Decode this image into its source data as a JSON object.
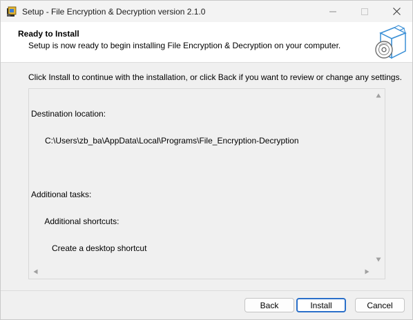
{
  "window": {
    "title": "Setup - File Encryption & Decryption version 2.1.0"
  },
  "header": {
    "title": "Ready to Install",
    "subtitle": "Setup is now ready to begin installing File Encryption & Decryption on your computer."
  },
  "body": {
    "instruction": "Click Install to continue with the installation, or click Back if you want to review or change any settings.",
    "memo": {
      "lines": [
        "Destination location:",
        "      C:\\Users\\zb_ba\\AppData\\Local\\Programs\\File_Encryption-Decryption",
        "",
        "Additional tasks:",
        "      Additional shortcuts:",
        "         Create a desktop shortcut"
      ]
    }
  },
  "buttons": {
    "back": "Back",
    "install": "Install",
    "cancel": "Cancel"
  },
  "icons": {
    "app": "setup-app-icon",
    "header": "install-box-disc-icon"
  },
  "colors": {
    "accent": "#2a6fc9",
    "header_bg": "#ffffff",
    "window_bg": "#f0f0f0"
  }
}
